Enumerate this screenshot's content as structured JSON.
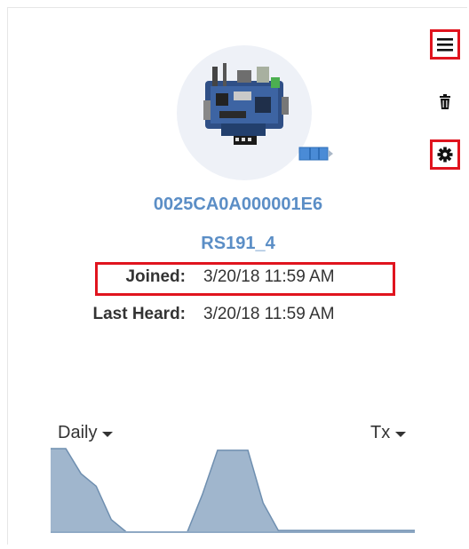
{
  "device": {
    "eui": "0025CA0A000001E6",
    "name": "RS191_4",
    "joined_label": "Joined:",
    "joined_value": "3/20/18 11:59 AM",
    "last_heard_label": "Last Heard:",
    "last_heard_value": "3/20/18 11:59 AM"
  },
  "toolbar": {
    "menu_icon": "hamburger-menu-icon",
    "delete_icon": "trash-icon",
    "settings_icon": "gear-icon"
  },
  "chart_controls": {
    "period_selected": "Daily",
    "metric_selected": "Tx"
  },
  "chart_data": {
    "type": "area",
    "x": [
      0,
      1,
      2,
      3,
      4,
      5,
      6,
      7,
      8,
      9,
      10,
      11,
      12,
      13,
      14,
      15,
      16,
      17,
      18,
      19,
      20,
      21,
      22,
      23,
      24
    ],
    "values": [
      1.0,
      1.0,
      0.7,
      0.55,
      0.15,
      0.0,
      0.0,
      0.0,
      0.0,
      0.0,
      0.45,
      0.98,
      0.98,
      0.98,
      0.35,
      0.02,
      0.02,
      0.02,
      0.02,
      0.02,
      0.02,
      0.02,
      0.02,
      0.02,
      0.02
    ],
    "ylim": [
      0,
      1
    ],
    "color": "#8fa9c4",
    "grid": false
  },
  "colors": {
    "accent": "#5b8ec6",
    "highlight": "#e0141e",
    "battery": "#4a8bd6"
  }
}
